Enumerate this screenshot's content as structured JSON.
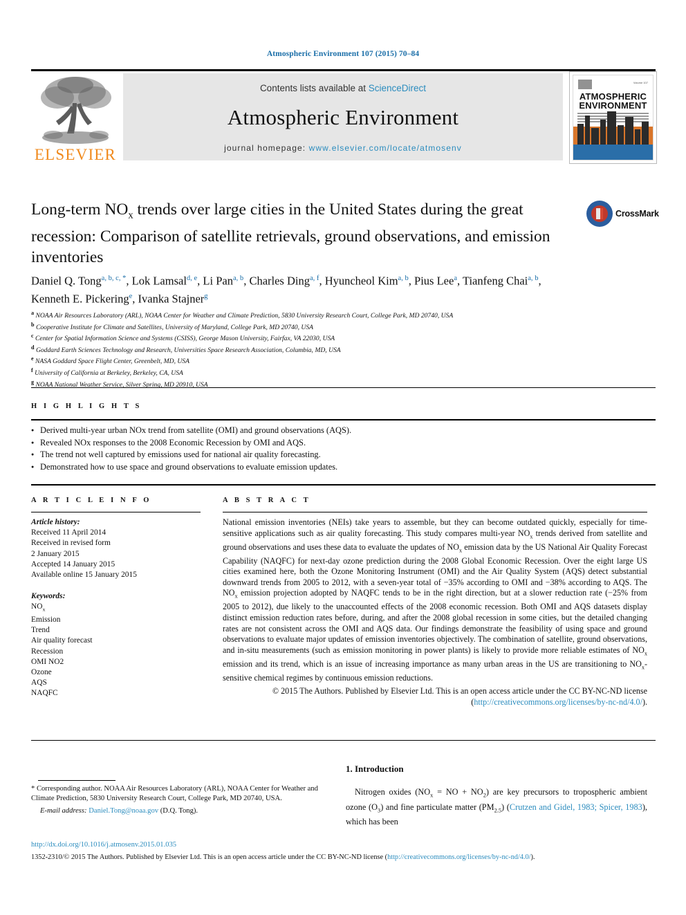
{
  "running_head": "Atmospheric Environment 107 (2015) 70–84",
  "masthead": {
    "publisher": "ELSEVIER",
    "contents_prefix": "Contents lists available at ",
    "contents_link": "ScienceDirect",
    "journal_name": "Atmospheric Environment",
    "homepage_prefix": "journal homepage: ",
    "homepage_url": "www.elsevier.com/locate/atmosenv",
    "cover": {
      "title_line1": "ATMOSPHERIC",
      "title_line2": "ENVIRONMENT",
      "volume_label": "Volume 107"
    }
  },
  "article": {
    "title_part1": "Long-term NO",
    "title_sub": "x",
    "title_part2": " trends over large cities in the United States during the great recession: Comparison of satellite retrievals, ground observations, and emission inventories",
    "crossmark_label": "CrossMark"
  },
  "authors": [
    {
      "name": "Daniel Q. Tong",
      "marks": "a, b, c, *"
    },
    {
      "name": "Lok Lamsal",
      "marks": "d, e"
    },
    {
      "name": "Li Pan",
      "marks": "a, b"
    },
    {
      "name": "Charles Ding",
      "marks": "a, f"
    },
    {
      "name": "Hyuncheol Kim",
      "marks": "a, b"
    },
    {
      "name": "Pius Lee",
      "marks": "a"
    },
    {
      "name": "Tianfeng Chai",
      "marks": "a, b"
    },
    {
      "name": "Kenneth E. Pickering",
      "marks": "e"
    },
    {
      "name": "Ivanka Stajner",
      "marks": "g"
    }
  ],
  "affiliations": [
    {
      "mark": "a",
      "text": "NOAA Air Resources Laboratory (ARL), NOAA Center for Weather and Climate Prediction, 5830 University Research Court, College Park, MD 20740, USA"
    },
    {
      "mark": "b",
      "text": "Cooperative Institute for Climate and Satellites, University of Maryland, College Park, MD 20740, USA"
    },
    {
      "mark": "c",
      "text": "Center for Spatial Information Science and Systems (CSISS), George Mason University, Fairfax, VA 22030, USA"
    },
    {
      "mark": "d",
      "text": "Goddard Earth Sciences Technology and Research, Universities Space Research Association, Columbia, MD, USA"
    },
    {
      "mark": "e",
      "text": "NASA Goddard Space Flight Center, Greenbelt, MD, USA"
    },
    {
      "mark": "f",
      "text": "University of California at Berkeley, Berkeley, CA, USA"
    },
    {
      "mark": "g",
      "text": "NOAA National Weather Service, Silver Spring, MD 20910, USA"
    }
  ],
  "highlights": {
    "label": "H I G H L I G H T S",
    "items": [
      "Derived multi-year urban NOx trend from satellite (OMI) and ground observations (AQS).",
      "Revealed NOx responses to the 2008 Economic Recession by OMI and AQS.",
      "The trend not well captured by emissions used for national air quality forecasting.",
      "Demonstrated how to use space and ground observations to evaluate emission updates."
    ]
  },
  "article_info": {
    "label": "A R T I C L E  I N F O",
    "history_header": "Article history:",
    "history": [
      "Received 11 April 2014",
      "Received in revised form",
      "2 January 2015",
      "Accepted 14 January 2015",
      "Available online 15 January 2015"
    ],
    "keywords_header": "Keywords:",
    "keywords": [
      "NOx",
      "Emission",
      "Trend",
      "Air quality forecast",
      "Recession",
      "OMI NO2",
      "Ozone",
      "AQS",
      "NAQFC"
    ]
  },
  "abstract": {
    "label": "A B S T R A C T",
    "paragraph_1": "National emission inventories (NEIs) take years to assemble, but they can become outdated quickly, especially for time-sensitive applications such as air quality forecasting. This study compares multi-year NO",
    "paragraph_2": " trends derived from satellite and ground observations and uses these data to evaluate the updates of NO",
    "paragraph_3": " emission data by the US National Air Quality Forecast Capability (NAQFC) for next-day ozone prediction during the 2008 Global Economic Recession. Over the eight large US cities examined here, both the Ozone Monitoring Instrument (OMI) and the Air Quality System (AQS) detect substantial downward trends from 2005 to 2012, with a seven-year total of −35% according to OMI and −38% according to AQS. The NO",
    "paragraph_4": " emission projection adopted by NAQFC tends to be in the right direction, but at a slower reduction rate (−25% from 2005 to 2012), due likely to the unaccounted effects of the 2008 economic recession. Both OMI and AQS datasets display distinct emission reduction rates before, during, and after the 2008 global recession in some cities, but the detailed changing rates are not consistent across the OMI and AQS data. Our findings demonstrate the feasibility of using space and ground observations to evaluate major updates of emission inventories objectively. The combination of satellite, ground observations, and in-situ measurements (such as emission monitoring in power plants) is likely to provide more reliable estimates of NO",
    "paragraph_5": " emission and its trend, which is an issue of increasing importance as many urban areas in the US are transitioning to NO",
    "paragraph_6": "-sensitive chemical regimes by continuous emission reductions.",
    "copyright": "© 2015 The Authors. Published by Elsevier Ltd. This is an open access article under the CC BY-NC-ND license (",
    "license_url": "http://creativecommons.org/licenses/by-nc-nd/4.0/",
    "copyright_tail": ")."
  },
  "footnote": {
    "corresponding": "* Corresponding author. NOAA Air Resources Laboratory (ARL), NOAA Center for Weather and Climate Prediction, 5830 University Research Court, College Park, MD 20740, USA.",
    "email_label": "E-mail address: ",
    "email": "Daniel.Tong@noaa.gov",
    "email_suffix": " (D.Q. Tong)."
  },
  "introduction": {
    "heading": "1. Introduction",
    "text_1": "Nitrogen oxides (NO",
    "sub_x": "x",
    "text_2": " = NO + NO",
    "sub_2": "2",
    "text_3": ") are key precursors to tropospheric ambient ozone (O",
    "sub_3": "3",
    "text_4": ") and fine particulate matter (PM",
    "sub_25": "2.5",
    "text_5": ") (",
    "citation": "Crutzen and Gidel, 1983; Spicer, 1983",
    "text_6": "), which has been"
  },
  "bottom": {
    "doi": "http://dx.doi.org/10.1016/j.atmosenv.2015.01.035",
    "issn_line_prefix": "1352-2310/© 2015 The Authors. Published by Elsevier Ltd. This is an open access article under the CC BY-NC-ND license (",
    "issn_license_url": "http://creativecommons.org/licenses/by-nc-nd/4.0/",
    "issn_line_suffix": ")."
  },
  "colors": {
    "link_blue": "#2b8cbe",
    "runhead_blue": "#1a6ea8",
    "elsevier_orange": "#f08a1e"
  }
}
